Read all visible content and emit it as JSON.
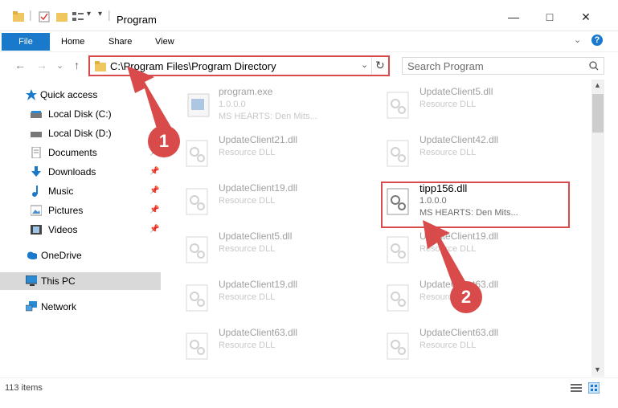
{
  "titlebar": {
    "title": "Program",
    "minimize": "—",
    "maximize": "□",
    "close": "✕"
  },
  "ribbon": {
    "file": "File",
    "tabs": [
      "Home",
      "Share",
      "View"
    ],
    "help": "?"
  },
  "nav": {
    "back": "←",
    "forward": "→",
    "recent": "⌄",
    "up": "↑",
    "address": "C:\\Program Files\\Program Directory",
    "refresh": "↻",
    "search_placeholder": "Search Program"
  },
  "sidebar": {
    "items": [
      {
        "label": "Quick access",
        "icon": "star-icon"
      },
      {
        "label": "Local Disk (C:)",
        "icon": "drive-icon"
      },
      {
        "label": "Local Disk (D:)",
        "icon": "drive-icon"
      },
      {
        "label": "Documents",
        "icon": "documents-icon"
      },
      {
        "label": "Downloads",
        "icon": "download-icon"
      },
      {
        "label": "Music",
        "icon": "music-icon"
      },
      {
        "label": "Pictures",
        "icon": "pictures-icon"
      },
      {
        "label": "Videos",
        "icon": "videos-icon"
      },
      {
        "label": "OneDrive",
        "icon": "cloud-icon"
      },
      {
        "label": "This PC",
        "icon": "computer-icon"
      },
      {
        "label": "Network",
        "icon": "network-icon"
      }
    ]
  },
  "files": [
    {
      "name": "program.exe",
      "line1": "1.0.0.0",
      "line2": "MS HEARTS: Den Mits..."
    },
    {
      "name": "UpdateClient5.dll",
      "line1": "Resource DLL",
      "line2": ""
    },
    {
      "name": "UpdateClient21.dll",
      "line1": "Resource DLL",
      "line2": ""
    },
    {
      "name": "UpdateClient42.dll",
      "line1": "Resource DLL",
      "line2": ""
    },
    {
      "name": "UpdateClient19.dll",
      "line1": "Resource DLL",
      "line2": ""
    },
    {
      "name": "tipp156.dll",
      "line1": "1.0.0.0",
      "line2": "MS HEARTS: Den Mits..."
    },
    {
      "name": "UpdateClient5.dll",
      "line1": "Resource DLL",
      "line2": ""
    },
    {
      "name": "UpdateClient19.dll",
      "line1": "Resource DLL",
      "line2": ""
    },
    {
      "name": "UpdateClient19.dll",
      "line1": "Resource DLL",
      "line2": ""
    },
    {
      "name": "UpdateClient63.dll",
      "line1": "Resource DLL",
      "line2": ""
    },
    {
      "name": "UpdateClient63.dll",
      "line1": "Resource DLL",
      "line2": ""
    },
    {
      "name": "UpdateClient63.dll",
      "line1": "Resource DLL",
      "line2": ""
    }
  ],
  "status": {
    "count": "113 items"
  },
  "annotations": {
    "step1": "1",
    "step2": "2",
    "color": "#d94a4a"
  }
}
